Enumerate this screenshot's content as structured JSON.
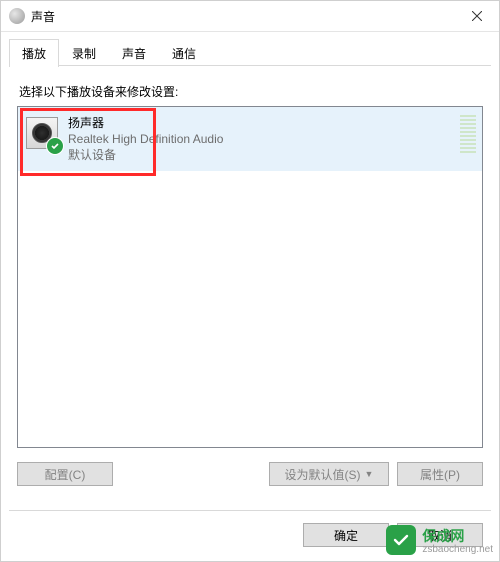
{
  "window": {
    "title": "声音"
  },
  "tabs": {
    "items": [
      {
        "label": "播放",
        "active": true
      },
      {
        "label": "录制",
        "active": false
      },
      {
        "label": "声音",
        "active": false
      },
      {
        "label": "通信",
        "active": false
      }
    ]
  },
  "instruction": "选择以下播放设备来修改设置:",
  "device": {
    "name": "扬声器",
    "driver": "Realtek High Definition Audio",
    "default_label": "默认设备"
  },
  "buttons": {
    "configure": "配置(C)",
    "set_default": "设为默认值(S)",
    "properties": "属性(P)",
    "ok": "确定",
    "cancel": "取消"
  },
  "watermark": {
    "brand": "保成网",
    "url": "zsbaocheng.net"
  }
}
